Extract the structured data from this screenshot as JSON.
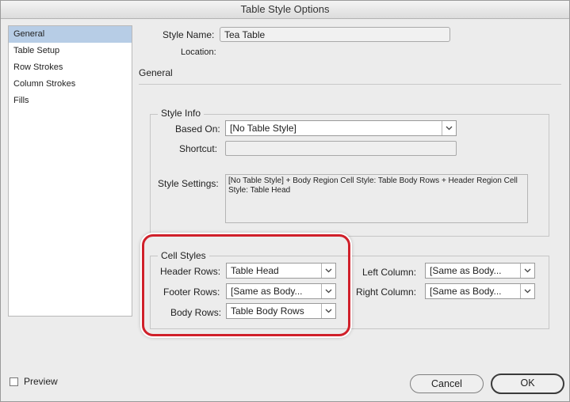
{
  "window": {
    "title": "Table Style Options"
  },
  "sidebar": {
    "items": [
      {
        "label": "General",
        "selected": true
      },
      {
        "label": "Table Setup"
      },
      {
        "label": "Row Strokes"
      },
      {
        "label": "Column Strokes"
      },
      {
        "label": "Fills"
      }
    ]
  },
  "header": {
    "style_name_label": "Style Name:",
    "style_name_value": "Tea Table",
    "location_label": "Location:",
    "section_title": "General"
  },
  "style_info": {
    "title": "Style Info",
    "based_on_label": "Based On:",
    "based_on_value": "[No Table Style]",
    "shortcut_label": "Shortcut:",
    "shortcut_value": "",
    "style_settings_label": "Style Settings:",
    "style_settings_value": "[No Table Style] + Body Region Cell Style: Table Body Rows + Header Region Cell Style: Table Head"
  },
  "cell_styles": {
    "title": "Cell Styles",
    "header_rows_label": "Header Rows:",
    "header_rows_value": "Table Head",
    "footer_rows_label": "Footer Rows:",
    "footer_rows_value": "[Same as Body...",
    "body_rows_label": "Body Rows:",
    "body_rows_value": "Table Body Rows",
    "left_column_label": "Left Column:",
    "left_column_value": "[Same as Body...",
    "right_column_label": "Right Column:",
    "right_column_value": "[Same as Body..."
  },
  "footer": {
    "preview_label": "Preview",
    "preview_checked": false,
    "cancel_label": "Cancel",
    "ok_label": "OK"
  },
  "colors": {
    "selection": "#b7cde6",
    "highlight": "#d0202a"
  },
  "icons": {
    "dropdown": "chevron-down-icon",
    "checkbox": "checkbox-icon"
  }
}
